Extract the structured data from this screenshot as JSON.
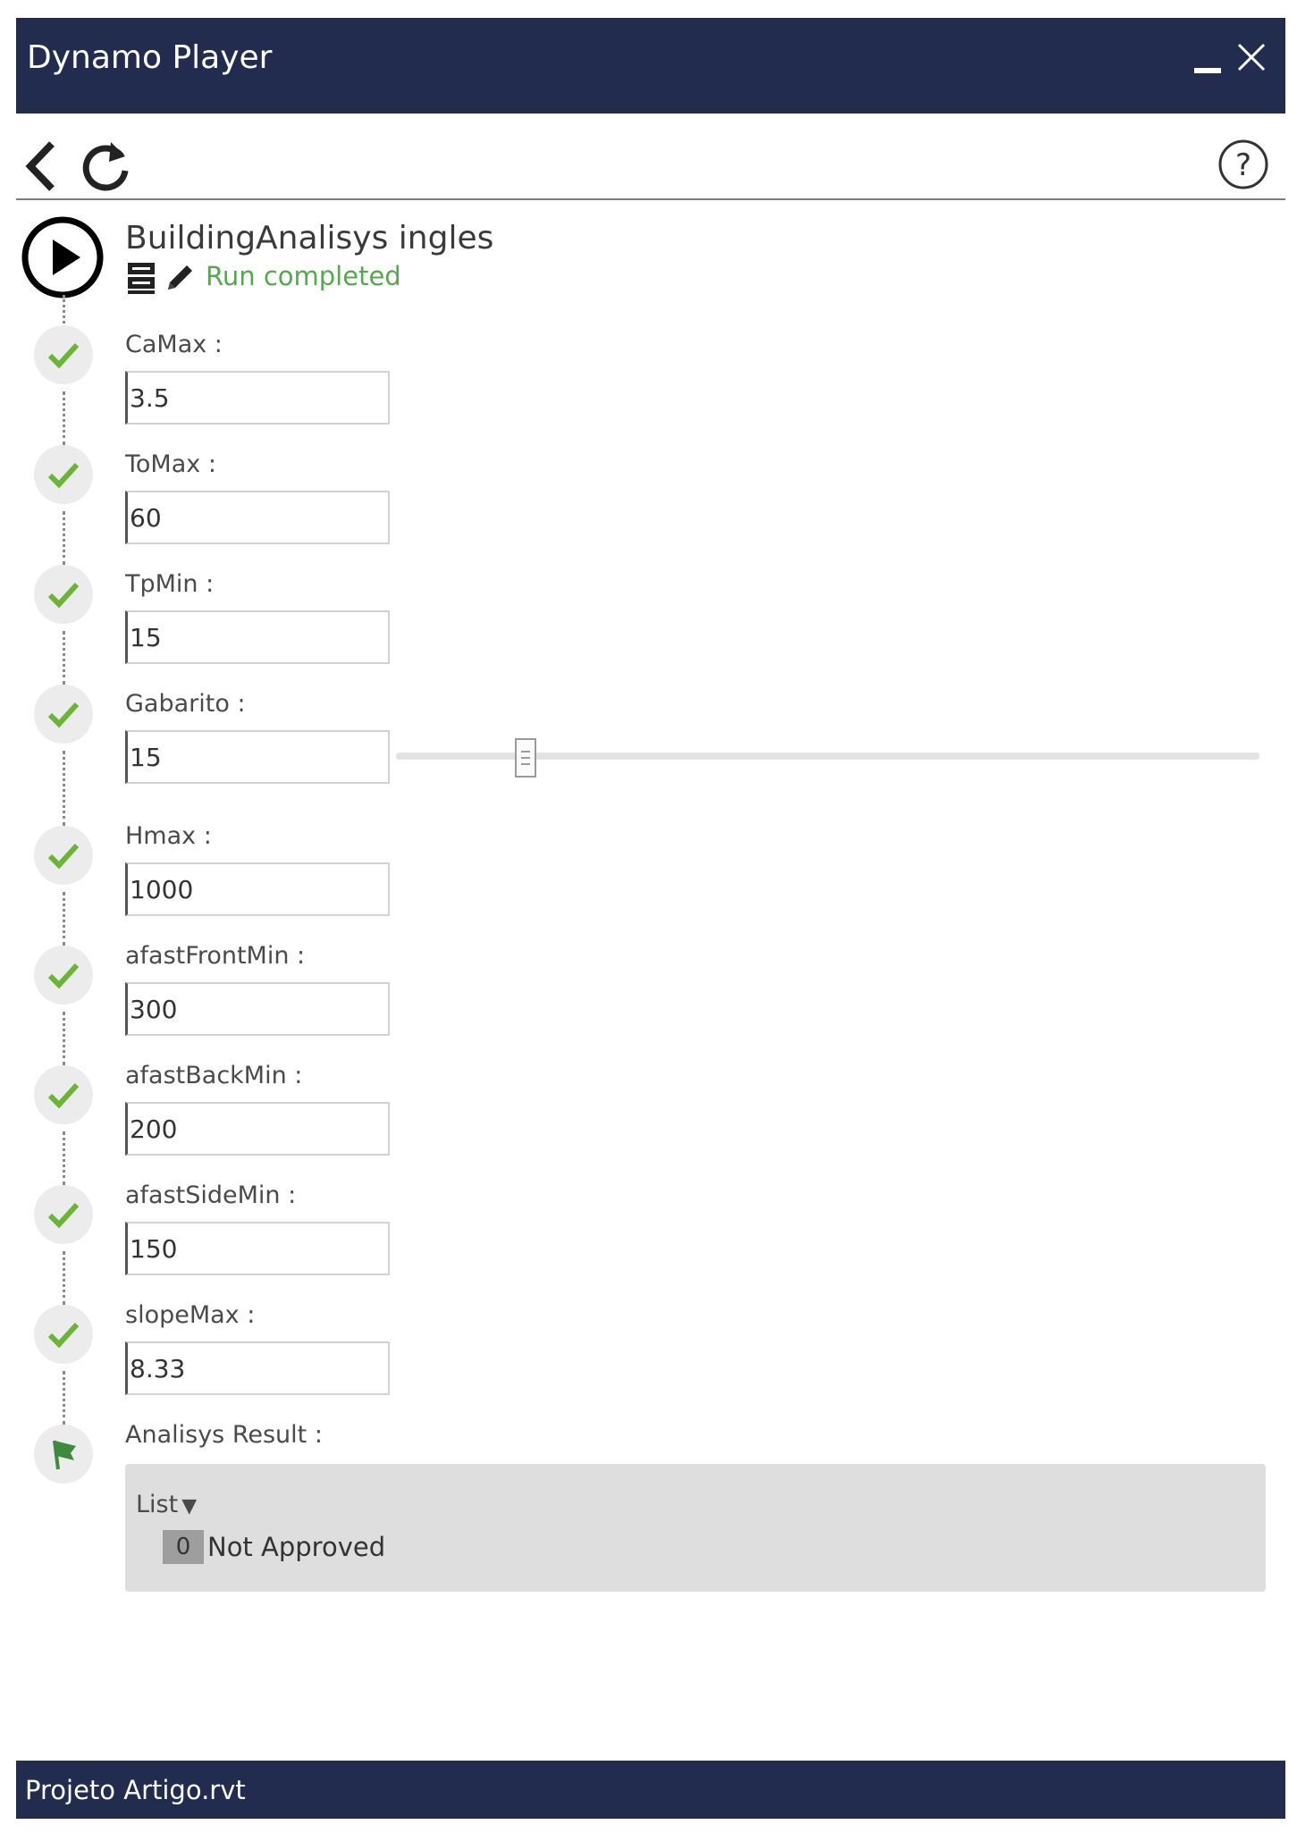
{
  "window": {
    "title": "Dynamo Player"
  },
  "toolbar": {
    "back_icon": "back-arrow-icon",
    "refresh_icon": "refresh-icon",
    "help_icon": "help-icon"
  },
  "graph": {
    "name": "BuildingAnalisys ingles",
    "status": "Run completed"
  },
  "inputs": [
    {
      "label": "CaMax :",
      "value": "3.5"
    },
    {
      "label": "ToMax :",
      "value": "60"
    },
    {
      "label": "TpMin :",
      "value": "15"
    },
    {
      "label": "Gabarito :",
      "value": "15",
      "slider_fraction": 0.15
    },
    {
      "label": "Hmax :",
      "value": "1000"
    },
    {
      "label": "afastFrontMin :",
      "value": "300"
    },
    {
      "label": "afastBackMin :",
      "value": "200"
    },
    {
      "label": "afastSideMin :",
      "value": "150"
    },
    {
      "label": "slopeMax :",
      "value": "8.33"
    }
  ],
  "output": {
    "label": "Analisys Result :",
    "list_label": "List",
    "items": [
      {
        "index": "0",
        "value": "Not Approved"
      }
    ]
  },
  "footer": {
    "file": "Projeto Artigo.rvt"
  },
  "colors": {
    "titlebar": "#222c4f",
    "status_green": "#56a84e",
    "check_green": "#6bb536",
    "flag_green": "#3f8a3c"
  }
}
